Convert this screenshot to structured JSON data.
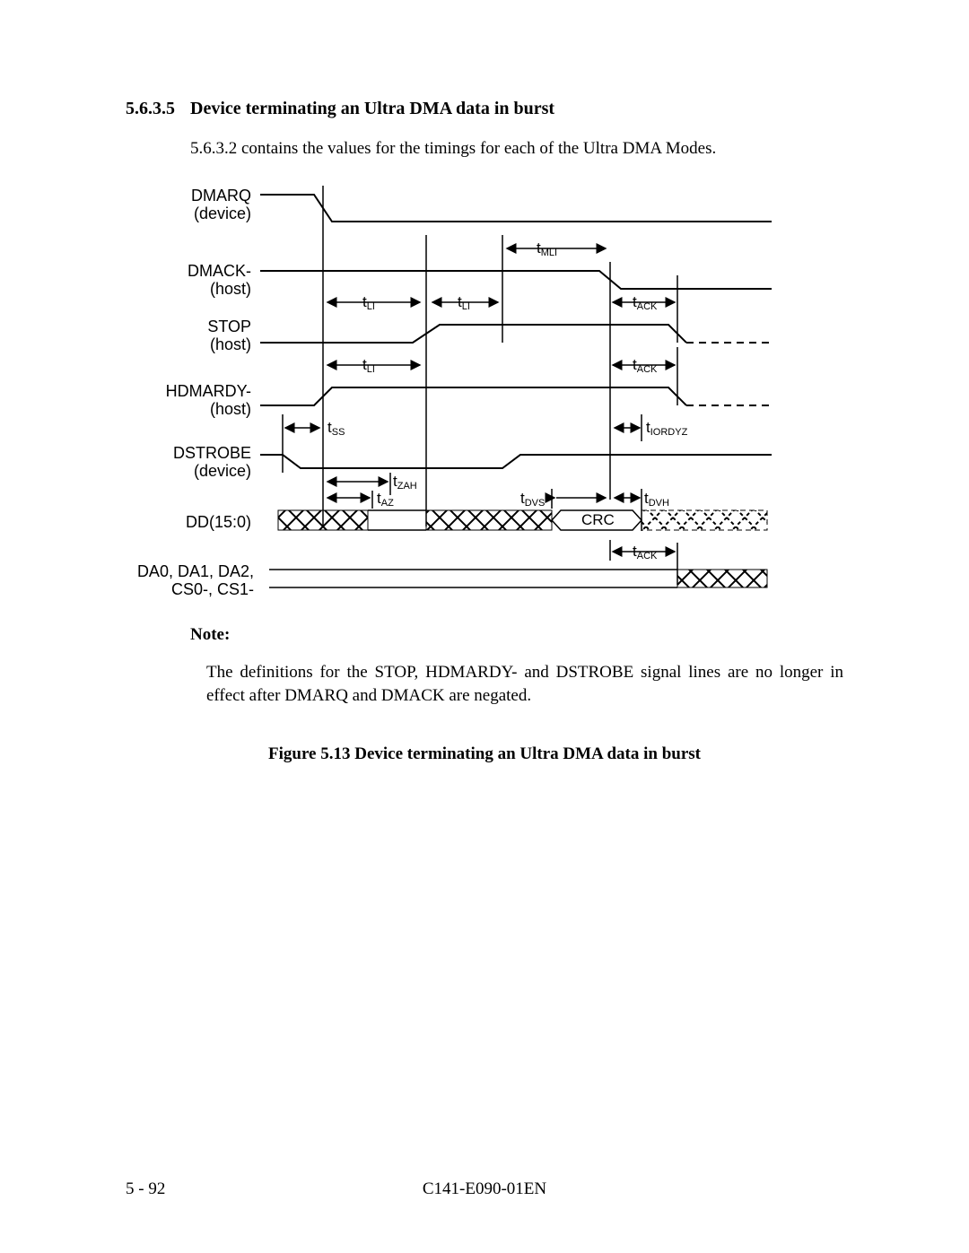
{
  "section": {
    "number": "5.6.3.5",
    "title": "Device terminating an Ultra DMA data in burst"
  },
  "intro": "5.6.3.2 contains the values for the timings for each of the Ultra DMA Modes.",
  "signals": {
    "dmarq": {
      "name": "DMARQ",
      "role": "(device)"
    },
    "dmack": {
      "name": "DMACK-",
      "role": "(host)"
    },
    "stop": {
      "name": "STOP",
      "role": "(host)"
    },
    "hdmardy": {
      "name": "HDMARDY-",
      "role": "(host)"
    },
    "dstrobe": {
      "name": "DSTROBE",
      "role": "(device)"
    },
    "dd": {
      "name": "DD(15:0)"
    },
    "addr": {
      "name": "DA0, DA1, DA2,",
      "name2": "CS0-, CS1-"
    }
  },
  "timings": {
    "tMLI": "t_MLI",
    "tLI": "t_LI",
    "tACK": "t_ACK",
    "tSS": "t_SS",
    "tIORDYZ": "t_IORDYZ",
    "tZAH": "t_ZAH",
    "tAZ": "t_AZ",
    "tDVS": "t_DVS",
    "tDVH": "t_DVH"
  },
  "crc_label": "CRC",
  "note": {
    "label": "Note:",
    "body": "The definitions for the STOP, HDMARDY- and DSTROBE signal lines are no longer in effect after DMARQ and DMACK are negated."
  },
  "figure_caption": "Figure 5.13  Device terminating an Ultra DMA data in burst",
  "footer": {
    "page": "5 - 92",
    "docid": "C141-E090-01EN"
  }
}
